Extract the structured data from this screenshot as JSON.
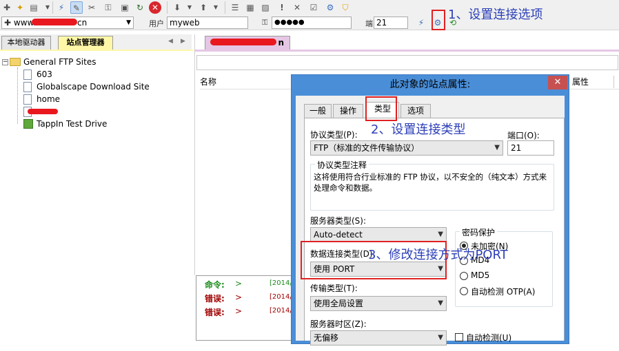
{
  "toolbar": {
    "icons": [
      "new-icon",
      "wizard-icon",
      "page-icon",
      "dropdown-icon",
      "connect-icon",
      "edit-icon",
      "tools-icon",
      "lock-icon",
      "refresh-icon",
      "stop-icon",
      "down-icon",
      "up-icon",
      "text-icon",
      "media-icon",
      "image-icon",
      "alert-icon",
      "delete-icon",
      "check-icon",
      "settings-icon",
      "shield-icon"
    ]
  },
  "address": {
    "host_prefix": "www.",
    "host_suffix": "cn",
    "user_label": "用户",
    "user_value": "myweb",
    "password_value": "●●●●●",
    "port_label": "端",
    "port_value": "21"
  },
  "left_tabs": [
    "本地驱动器",
    "站点管理器"
  ],
  "tree": {
    "root": "General FTP Sites",
    "items": [
      "603",
      "Globalscape Download Site",
      "home",
      "",
      "TappIn Test Drive"
    ]
  },
  "right_tab": "n",
  "columns": {
    "name": "名称",
    "attr": "属性"
  },
  "log": {
    "rows": [
      {
        "label": "命令:",
        "arrow": ">",
        "time": "[2014/"
      },
      {
        "label": "错误:",
        "arrow": ">",
        "time": "[2014/"
      },
      {
        "label": "错误:",
        "arrow": ">",
        "time": "[2014/"
      }
    ]
  },
  "dialog": {
    "title": "此对象的站点属性:",
    "close": "✕",
    "tabs": [
      "一般",
      "操作",
      "类型",
      "选项"
    ],
    "protocol_label": "协议类型(P):",
    "protocol_value": "FTP（标准的文件传输协议）",
    "port_label": "端口(O):",
    "port_value": "21",
    "note_title": "协议类型注释",
    "note_text": "这将使用符合行业标准的 FTP 协议，以不安全的（纯文本）方式来处理命令和数据。",
    "server_type_label": "服务器类型(S):",
    "server_type_value": "Auto-detect",
    "data_conn_label": "数据连接类型(D):",
    "data_conn_value": "使用 PORT",
    "transfer_label": "传输类型(T):",
    "transfer_value": "使用全局设置",
    "timezone_label": "服务器时区(Z):",
    "timezone_value": "无偏移",
    "password_group": "密码保护",
    "pw_options": [
      "未加密(N)",
      "MD4",
      "MD5",
      "自动检测 OTP(A)"
    ],
    "auto_detect": "自动检测(U)"
  },
  "annotations": {
    "step1": "1、设置连接选项",
    "step2": "2、设置连接类型",
    "step3": "3、修改连接方式为PORT"
  },
  "colors": {
    "annotation": "#2c3fb8",
    "highlight": "#e02020",
    "dialog_frame": "#4a8ed8"
  }
}
